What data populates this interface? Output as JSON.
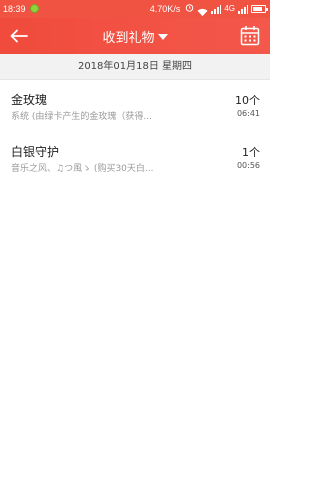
{
  "status_bar": {
    "time": "18:39",
    "speed": "4.70K/s",
    "network": "4G",
    "battery_level": 0.8,
    "bg_color": "#f15342"
  },
  "header": {
    "title": "收到礼物",
    "back_icon": "back-arrow-icon",
    "calendar_icon": "calendar-icon",
    "accent_color": "#f04b3d"
  },
  "date_bar": {
    "date": "2018年01月18日 星期四"
  },
  "gifts": [
    {
      "name": "金玫瑰",
      "desc": "系统 (由绿卡产生的金玫瑰（获得...",
      "count": "10个",
      "time": "06:41"
    },
    {
      "name": "白银守护",
      "desc": "音乐之风、♫つ風ゝ (购买30天白...",
      "count": "1个",
      "time": "00:56"
    }
  ]
}
